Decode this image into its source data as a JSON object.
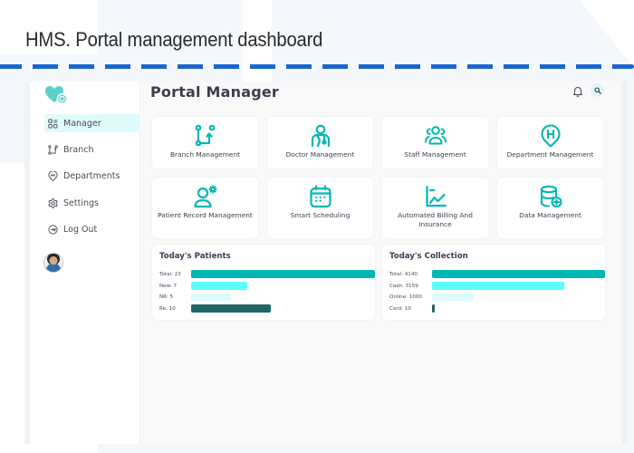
{
  "slide": {
    "title": "HMS. Portal management dashboard"
  },
  "sidebar": {
    "logo_icon": "heart-gear-icon",
    "items": [
      {
        "label": "Manager",
        "icon": "grid-icon",
        "active": true
      },
      {
        "label": "Branch",
        "icon": "branch-icon",
        "active": false
      },
      {
        "label": "Departments",
        "icon": "hospital-pin-icon",
        "active": false
      },
      {
        "label": "Settings",
        "icon": "gear-icon",
        "active": false
      },
      {
        "label": "Log Out",
        "icon": "logout-icon",
        "active": false
      }
    ],
    "avatar": "user-avatar"
  },
  "header": {
    "title": "Portal Manager",
    "notification_icon": "bell-icon",
    "search_icon": "search-icon"
  },
  "tiles": [
    {
      "label": "Branch Management",
      "icon": "branch-icon"
    },
    {
      "label": "Doctor Management",
      "icon": "doctor-icon"
    },
    {
      "label": "Staff Management",
      "icon": "staff-group-icon"
    },
    {
      "label": "Department Management",
      "icon": "hospital-pin-icon"
    },
    {
      "label": "Patient Record Management",
      "icon": "patient-settings-icon"
    },
    {
      "label": "Smart Scheduling",
      "icon": "calendar-icon"
    },
    {
      "label": "Automated Billing And Insurance",
      "icon": "billing-chart-icon"
    },
    {
      "label": "Data Management",
      "icon": "database-add-icon"
    }
  ],
  "colors": {
    "accent": "#00b7b3",
    "accent_light": "#5dfdfd",
    "accent_pale": "#dcfcfc",
    "accent_dark": "#1f6563",
    "active_nav_bg": "#e0fbfb"
  },
  "chart_data": [
    {
      "type": "bar",
      "orientation": "horizontal",
      "title": "Today's Patients",
      "categories": [
        "Total",
        "New",
        "NR",
        "Re"
      ],
      "labels": [
        "Total: 23",
        "New: 7",
        "NR: 5",
        "Re: 10"
      ],
      "values": [
        23,
        7,
        5,
        10
      ],
      "xlim": [
        0,
        23
      ],
      "colors": [
        "#00b7b3",
        "#5dfdfd",
        "#dcfcfc",
        "#1f6563"
      ]
    },
    {
      "type": "bar",
      "orientation": "horizontal",
      "title": "Today's Collection",
      "categories": [
        "Total",
        "Cash",
        "Online",
        "Card"
      ],
      "labels": [
        "Total: 4140",
        "Cash: 3159",
        "Online: 1000",
        "Card: 10"
      ],
      "values": [
        4140,
        3159,
        1000,
        10
      ],
      "xlim": [
        0,
        4140
      ],
      "colors": [
        "#00b7b3",
        "#5dfdfd",
        "#dcfcfc",
        "#1f6563"
      ]
    }
  ]
}
